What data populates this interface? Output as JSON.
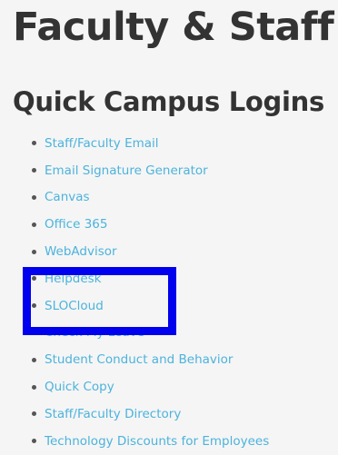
{
  "page": {
    "title": "Faculty & Staff",
    "section_title": "Quick Campus Logins"
  },
  "logins": {
    "items": [
      {
        "label": "Staff/Faculty Email"
      },
      {
        "label": "Email Signature Generator"
      },
      {
        "label": "Canvas"
      },
      {
        "label": "Office 365"
      },
      {
        "label": "WebAdvisor"
      },
      {
        "label": "Helpdesk"
      },
      {
        "label": "SLOCloud"
      },
      {
        "label": "Check My Leave"
      },
      {
        "label": "Student Conduct and Behavior"
      },
      {
        "label": "Quick Copy"
      },
      {
        "label": "Staff/Faculty Directory"
      },
      {
        "label": "Technology Discounts for Employees"
      }
    ]
  },
  "colors": {
    "heading": "#333333",
    "link": "#4cb3dc",
    "background": "#f5f5f5",
    "highlight_box": "#0000ee"
  }
}
